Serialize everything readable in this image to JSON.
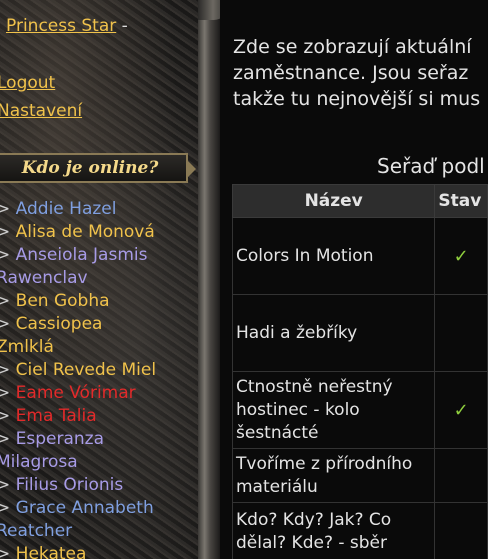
{
  "sidebar": {
    "user": {
      "name": "Princess Star",
      "separator": "-"
    },
    "menu": {
      "logout": "Logout",
      "settings": "Nastavení"
    },
    "online_title": "Kdo je online?",
    "online_users": [
      {
        "bullet": ">",
        "name": "Addie Hazel",
        "color": "blue"
      },
      {
        "bullet": ">",
        "name": "Alisa de Monová",
        "color": "yellow"
      },
      {
        "bullet": ">",
        "name": "Anseiola Jasmis Rawenclav",
        "color": "purple"
      },
      {
        "bullet": ">",
        "name": "Ben Gobha",
        "color": "yellow"
      },
      {
        "bullet": ">",
        "name": "Cassiopea Zmlklá",
        "color": "yellow"
      },
      {
        "bullet": ">",
        "name": "Ciel Revede Miel",
        "color": "yellow"
      },
      {
        "bullet": ">",
        "name": "Eame Vórimar",
        "color": "red"
      },
      {
        "bullet": ">",
        "name": "Ema Talia",
        "color": "red"
      },
      {
        "bullet": ">",
        "name": "Esperanza Milagrosa",
        "color": "purple"
      },
      {
        "bullet": ">",
        "name": "Filius Orionis",
        "color": "purple"
      },
      {
        "bullet": ">",
        "name": "Grace Annabeth Reatcher",
        "color": "blue"
      },
      {
        "bullet": ">",
        "name": "Hekatea",
        "color": "yellow"
      }
    ]
  },
  "main": {
    "intro_lines": [
      "Zde se zobrazují aktuální",
      "zaměstnance. Jsou seřaz",
      "takže tu nejnovější si mus"
    ],
    "sort_label": "Seřaď podl",
    "table": {
      "headers": {
        "name": "Název",
        "state": "Stav"
      },
      "rows": [
        {
          "name": "Colors In Motion",
          "state": "✓"
        },
        {
          "name": "Hadi a žebříky",
          "state": ""
        },
        {
          "name": "Ctnostně neřestný hostinec - kolo šestnácté",
          "state": "✓"
        },
        {
          "name": "Tvoříme z přírodního materiálu",
          "state": ""
        },
        {
          "name": "Kdo? Kdy? Jak? Co dělal? Kde? - sběr",
          "state": ""
        }
      ]
    }
  },
  "colors": {
    "link_yellow": "#f0c24b",
    "blue": "#7f9fe0",
    "purple": "#a79be6",
    "red": "#e22a2a",
    "check_green": "#8fcf3e"
  }
}
